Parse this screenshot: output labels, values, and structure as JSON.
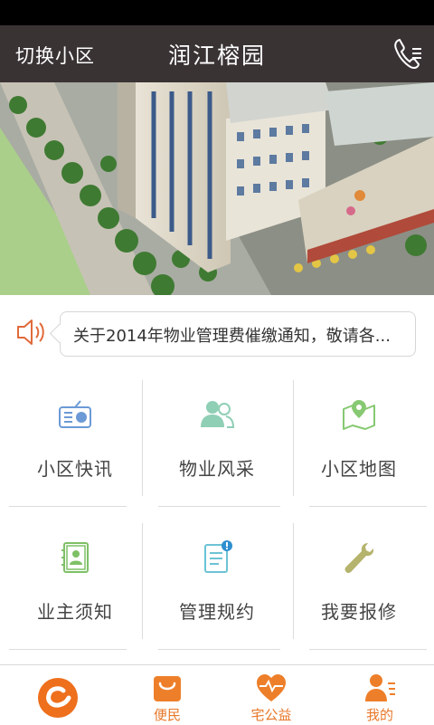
{
  "header": {
    "switch_community": "切换小区",
    "title": "润江榕园",
    "phone_icon": "phone-icon"
  },
  "banner": {
    "subject": "community building aerial photo"
  },
  "notice": {
    "icon": "speaker-icon",
    "text": "关于2014年物业管理费催缴通知，敬请各..."
  },
  "grid": [
    {
      "label": "小区快讯",
      "icon": "radio-icon",
      "color": "#6c9ad6"
    },
    {
      "label": "物业风采",
      "icon": "people-icon",
      "color": "#8fcfb5"
    },
    {
      "label": "小区地图",
      "icon": "map-icon",
      "color": "#86c972"
    },
    {
      "label": "业主须知",
      "icon": "contact-card-icon",
      "color": "#7ec066"
    },
    {
      "label": "管理规约",
      "icon": "rules-document-icon",
      "color": "#6cc3d5"
    },
    {
      "label": "我要报修",
      "icon": "wrench-icon",
      "color": "#b5b36c"
    }
  ],
  "tabbar": {
    "color": "#e8782a",
    "tabs": [
      {
        "label": "",
        "icon": "home-logo-icon"
      },
      {
        "label": "便民",
        "icon": "shopping-bag-icon"
      },
      {
        "label": "宅公益",
        "icon": "heart-pulse-icon"
      },
      {
        "label": "我的",
        "icon": "profile-icon"
      }
    ]
  }
}
